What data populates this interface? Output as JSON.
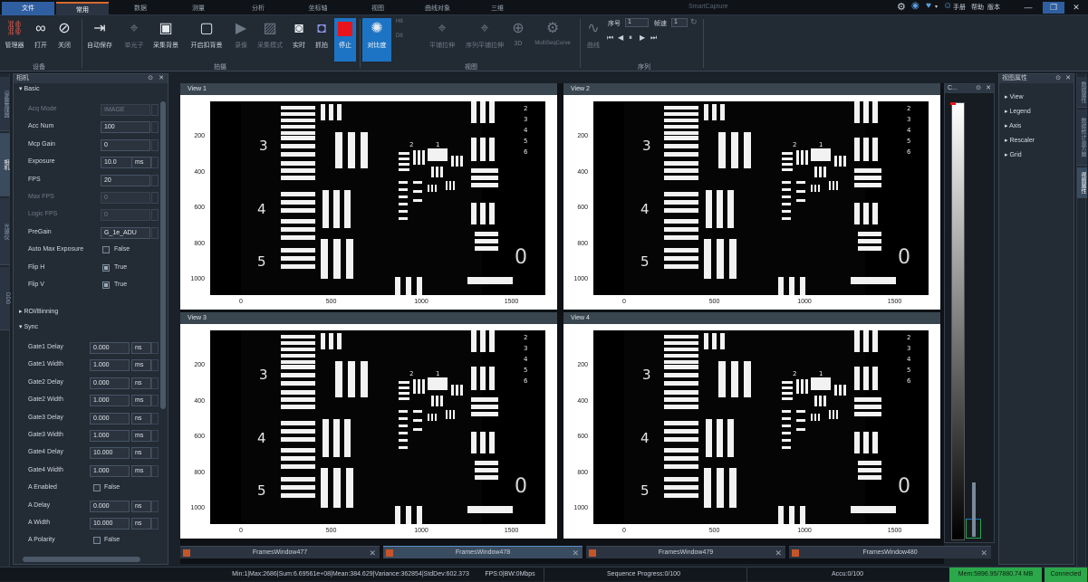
{
  "tabs": {
    "file": "文件",
    "items": [
      "常用",
      "数据",
      "测量",
      "分析",
      "坐标轴",
      "视图",
      "曲线对象",
      "三维"
    ]
  },
  "window_title": "SmartCapture",
  "titlebar": {
    "help1": "手册",
    "help2": "帮助",
    "help3": "版本"
  },
  "ribbon": {
    "buttons": [
      "管理器",
      "打开",
      "关闭",
      "自动保存",
      "单光子",
      "采集背景",
      "开启扣背景",
      "录像",
      "采集模式",
      "实时",
      "抓拍",
      "停止",
      "对比度",
      "平铺拉伸",
      "序列平铺拉伸",
      "3D",
      "MultiSeqCurve",
      "曲线"
    ],
    "small_labels": {
      "h8": "H8",
      "d8": "D8",
      "seq": "序号",
      "seq_val": "1",
      "speed": "帧速",
      "speed_val": "1"
    },
    "groups": [
      "设备",
      "拍摄",
      "视图",
      "序列"
    ]
  },
  "left_strip": [
    "设备管理器",
    "相机",
    "光源仪",
    "DDG"
  ],
  "camera_panel": {
    "title": "相机",
    "basic": "Basic",
    "props": [
      {
        "label": "Acq Mode",
        "value": "IMAGE",
        "disabled": true
      },
      {
        "label": "Acc Num",
        "value": "100",
        "disabled": false
      },
      {
        "label": "Mcp Gain",
        "value": "0",
        "disabled": false
      },
      {
        "label": "Exposure",
        "value": "10.0",
        "unit": "ms",
        "disabled": false
      },
      {
        "label": "FPS",
        "value": "20",
        "disabled": false
      },
      {
        "label": "Max FPS",
        "value": "0",
        "disabled": true
      },
      {
        "label": "Logic FPS",
        "value": "0",
        "disabled": true
      },
      {
        "label": "PreGain",
        "value": "G_1e_ADU",
        "disabled": false
      }
    ],
    "checks": [
      {
        "label": "Auto Max Exposure",
        "value": "False",
        "on": false
      },
      {
        "label": "Flip H",
        "value": "True",
        "on": true
      },
      {
        "label": "Flip V",
        "value": "True",
        "on": true
      }
    ],
    "roi": "ROI/Binning",
    "sync": "Sync",
    "sync_props": [
      {
        "label": "Gate1 Delay",
        "value": "0.000",
        "unit": "ns"
      },
      {
        "label": "Gate1 Width",
        "value": "1.000",
        "unit": "ms"
      },
      {
        "label": "Gate2 Delay",
        "value": "0.000",
        "unit": "ns"
      },
      {
        "label": "Gate2 Width",
        "value": "1.000",
        "unit": "ms"
      },
      {
        "label": "Gate3 Delay",
        "value": "0.000",
        "unit": "ns"
      },
      {
        "label": "Gate3 Width",
        "value": "1.000",
        "unit": "ms"
      },
      {
        "label": "Gate4 Delay",
        "value": "10.000",
        "unit": "ns"
      },
      {
        "label": "Gate4 Width",
        "value": "1.000",
        "unit": "ms"
      }
    ],
    "a_enabled": {
      "label": "A Enabled",
      "value": "False"
    },
    "a_props": [
      {
        "label": "A Delay",
        "value": "0.000",
        "unit": "ns"
      },
      {
        "label": "A Width",
        "value": "10.000",
        "unit": "ns"
      }
    ],
    "a_polarity": {
      "label": "A Polarity",
      "value": "False"
    }
  },
  "views": [
    {
      "title": "View 1"
    },
    {
      "title": "View 2"
    },
    {
      "title": "View 3"
    },
    {
      "title": "View 4"
    }
  ],
  "yticks": [
    "200",
    "400",
    "600",
    "800",
    "1000"
  ],
  "xticks": [
    "0",
    "500",
    "1000",
    "1500"
  ],
  "target_numbers": {
    "n3": "3",
    "n4": "4",
    "n5": "5",
    "n0": "0",
    "small": [
      "2",
      "1",
      "2",
      "3",
      "4",
      "5",
      "6"
    ]
  },
  "doc_tabs": [
    "FramesWindow477",
    "FramesWindow478",
    "FramesWindow479",
    "FramesWindow480"
  ],
  "colorbar": {
    "title": "C..."
  },
  "right_panel": {
    "title": "视图属性",
    "items": [
      "View",
      "Legend",
      "Axis",
      "Rescaler",
      "Grid"
    ]
  },
  "right_strip": [
    "数据属性",
    "数据统计/直方图",
    "视图属性"
  ],
  "status": {
    "stats": "Min:1|Max:2686|Sum:6.69561e+08|Mean:384.629|Variance:362854|StdDev:602.373",
    "fps": "FPS:0|BW:0Mbps",
    "progress": "Sequence Progress:0/100",
    "accu": "Accu:0/100",
    "mem": "Mem:5896.95/7880.74 MB",
    "conn": "Connected"
  },
  "colors": {
    "accent": "#1d74c4",
    "file_tab": "#2f5fa0",
    "stop": "#e8141a",
    "connected": "#2aa84a"
  }
}
